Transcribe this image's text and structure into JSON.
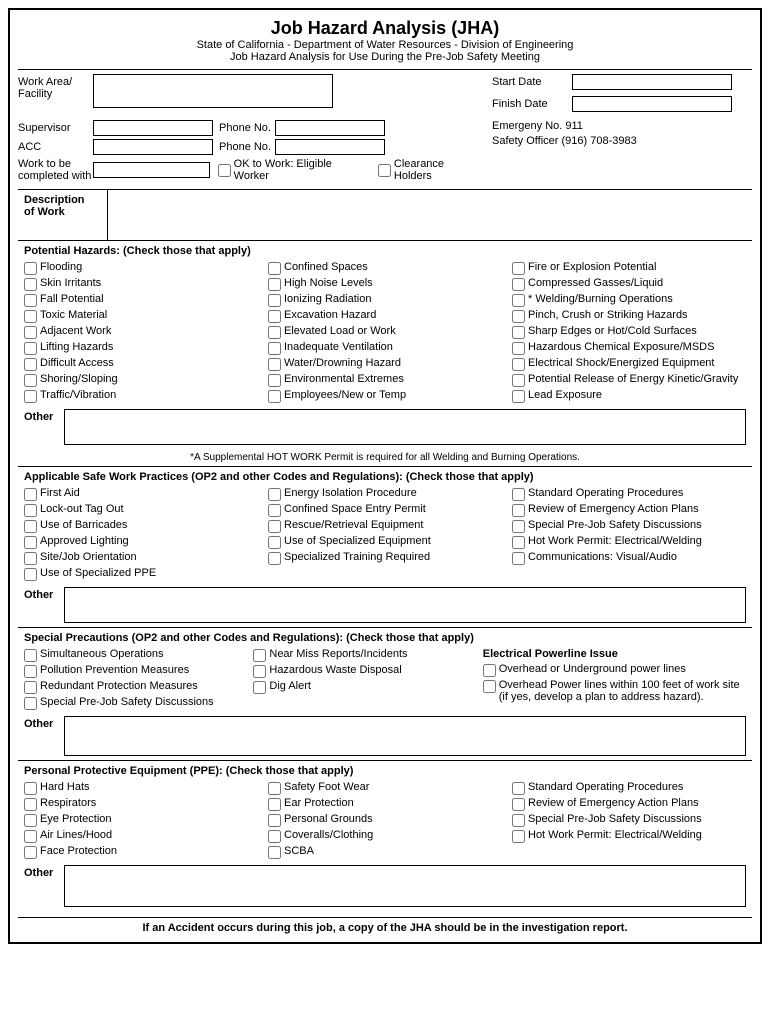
{
  "header": {
    "title": "Job Hazard Analysis (JHA)",
    "subtitle1": "State of California - Department of Water Resources - Division of Engineering",
    "subtitle2": "Job Hazard Analysis for Use During the Pre-Job Safety Meeting"
  },
  "fields": {
    "work_area_label": "Work Area/\nFacility",
    "start_date_label": "Start Date",
    "finish_date_label": "Finish Date",
    "supervisor_label": "Supervisor",
    "phone_no_label": "Phone No.",
    "emergency_label": "Emergeny No. 911",
    "acc_label": "ACC",
    "phone_no2_label": "Phone No.",
    "safety_officer_label": "Safety Officer (916) 708-3983",
    "work_completed_label": "Work to be\ncompleted with",
    "ok_to_work_label": "OK to Work: Eligible Worker",
    "clearance_holders_label": "Clearance Holders"
  },
  "description": {
    "label": "Description\nof Work"
  },
  "potential_hazards": {
    "title": "Potential Hazards: (Check those that apply)",
    "col1": [
      "Flooding",
      "Skin Irritants",
      "Fall Potential",
      "Toxic Material",
      "Adjacent Work",
      "Lifting Hazards",
      "Difficult Access",
      "Shoring/Sloping",
      "Traffic/Vibration"
    ],
    "col2": [
      "Confined Spaces",
      "High Noise Levels",
      "Ionizing Radiation",
      "Excavation Hazard",
      "Elevated Load or Work",
      "Inadequate Ventilation",
      "Water/Drowning Hazard",
      "Environmental Extremes",
      "Employees/New or Temp"
    ],
    "col3": [
      "Fire or Explosion Potential",
      "Compressed Gasses/Liquid",
      "* Welding/Burning Operations",
      "Pinch, Crush or Striking Hazards",
      "Sharp Edges or Hot/Cold Surfaces",
      "Hazardous Chemical Exposure/MSDS",
      "Electrical Shock/Energized Equipment",
      "Potential Release of Energy Kinetic/Gravity",
      "Lead Exposure"
    ]
  },
  "hot_work_note": "*A Supplemental HOT WORK Permit is required for all Welding and Burning Operations.",
  "applicable_safe": {
    "title": "Applicable Safe Work Practices (OP2 and other Codes and Regulations): (Check those that apply)",
    "col1": [
      "First Aid",
      "Lock-out Tag Out",
      "Use of Barricades",
      "Approved Lighting",
      "Site/Job Orientation",
      "Use of Specialized PPE"
    ],
    "col2": [
      "Energy Isolation Procedure",
      "Confined Space Entry Permit",
      "Rescue/Retrieval Equipment",
      "Use of Specialized Equipment",
      "Specialized Training Required"
    ],
    "col3": [
      "Standard Operating Procedures",
      "Review of Emergency Action Plans",
      "Special Pre-Job Safety Discussions",
      "Hot Work Permit: Electrical/Welding",
      "Communications: Visual/Audio"
    ]
  },
  "special_precautions": {
    "title": "Special Precautions (OP2 and other Codes and Regulations): (Check those that apply)",
    "col1": [
      "Simultaneous Operations",
      "Pollution Prevention Measures",
      "Redundant Protection Measures",
      "Special Pre-Job Safety Discussions"
    ],
    "col2": [
      "Near Miss Reports/Incidents",
      "Hazardous Waste Disposal",
      "Dig Alert"
    ],
    "col3_title": "Electrical Powerline Issue",
    "col3": [
      "Overhead or Underground power lines",
      "Overhead Power lines within 100 feet of work site (if yes, develop a plan to address hazard)."
    ]
  },
  "ppe": {
    "title": "Personal Protective Equipment (PPE): (Check those that apply)",
    "col1": [
      "Hard Hats",
      "Respirators",
      "Eye Protection",
      "Air Lines/Hood",
      "Face Protection"
    ],
    "col2": [
      "Safety Foot Wear",
      "Ear Protection",
      "Personal Grounds",
      "Coveralls/Clothing",
      "SCBA"
    ],
    "col3": [
      "Standard Operating Procedures",
      "Review of Emergency Action Plans",
      "Special Pre-Job Safety Discussions",
      "Hot Work Permit: Electrical/Welding"
    ]
  },
  "bottom_note": "If an Accident occurs during this job, a copy of the JHA should be in the investigation report."
}
